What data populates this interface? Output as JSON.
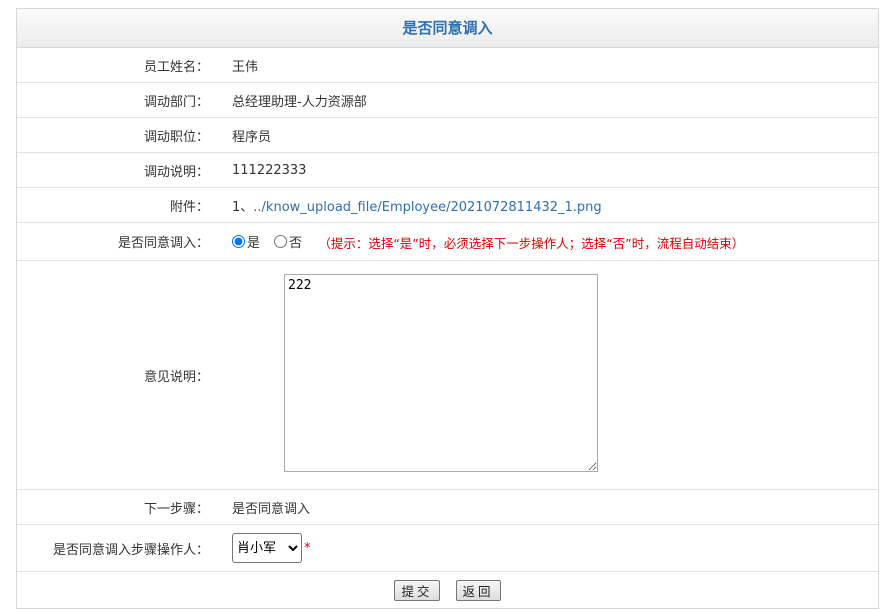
{
  "title": "是否同意调入",
  "fields": {
    "name": {
      "label": "员工姓名：",
      "value": "王伟"
    },
    "dept": {
      "label": "调动部门：",
      "value": "总经理助理-人力资源部"
    },
    "position": {
      "label": "调动职位：",
      "value": "程序员"
    },
    "desc": {
      "label": "调动说明：",
      "value": "111222333"
    },
    "attach": {
      "label": "附件：",
      "prefix": "1、",
      "link": "../know_upload_file/Employee/2021072811432_1.png"
    },
    "agree": {
      "label": "是否同意调入：",
      "yes": "是",
      "no": "否",
      "selected": "是",
      "hint": "（提示：选择“是”时，必须选择下一步操作人；选择“否”时，流程自动结束）"
    },
    "opinion": {
      "label": "意见说明：",
      "value": "222"
    },
    "next_step": {
      "label": "下一步骤：",
      "value": "是否同意调入"
    },
    "operator": {
      "label": "是否同意调入步骤操作人：",
      "selected": "肖小军",
      "required_mark": "*"
    }
  },
  "buttons": {
    "submit": "提交",
    "back": "返回"
  },
  "colors": {
    "title": "#2f6fb0",
    "link": "#2f6fb0",
    "hint": "#e00000"
  }
}
